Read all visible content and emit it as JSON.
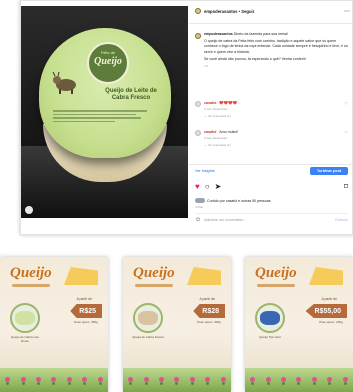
{
  "post": {
    "account": "empoderasantos • Seguir",
    "cheese_label": {
      "badge_top": "Feito de",
      "badge_main": "Queijo",
      "title": "Queijo de Leite de Cabra Fresco"
    },
    "caption": {
      "user": "empoderasantos",
      "lead": "Direto da fazenda para sua mesa!",
      "body": "O queijo de cabra da Feita feito com carinho, tradição e aquele sabor que só quem conhece o fogo de lenha da roça entende. Cada unidade sempre é fresquinho e leve, é só servir e quem vive a história.",
      "cta": "Se você ainda não provou, tá esperando o quê? Venha conferir!",
      "time": "4 d"
    },
    "comments": [
      {
        "user": "casaful",
        "text": "❤️❤️❤️❤️",
        "meta": "2 sem  Responder",
        "replies": "— Ver respostas (1)"
      },
      {
        "user": "casaful",
        "text": "Amo muito!!",
        "meta": "2 sem  Responder",
        "replies": "— Ver respostas (1)"
      }
    ],
    "insights_label": "Ver insights",
    "boost_label": "Turbinar post",
    "likes_text": "Curtido por casaful e outras 50 pessoas",
    "time_ago": "4 dias",
    "comment_placeholder": "Adicione um comentário...",
    "post_label": "Publicar"
  },
  "stories": [
    {
      "title": "Queijo",
      "product_caption": "Queijo de Cabra com Ervas",
      "from_label": "A partir de",
      "price": "R$25",
      "price_note": "Peso aprox. 250g"
    },
    {
      "title": "Queijo",
      "product_caption": "Queijo de Cabra Fresco",
      "from_label": "A partir de",
      "price": "R$28",
      "price_note": "Peso aprox. 300g"
    },
    {
      "title": "Queijo",
      "product_caption": "Queijo Tipo Azul",
      "from_label": "A partir de",
      "price": "R$55,00",
      "price_note": "Peso aprox. 200g"
    }
  ]
}
